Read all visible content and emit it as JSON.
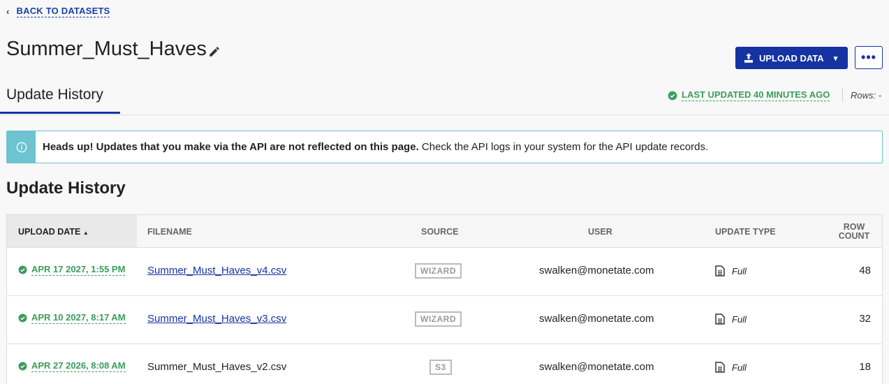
{
  "nav": {
    "back_label": "BACK TO DATASETS"
  },
  "header": {
    "title": "Summer_Must_Haves",
    "upload_label": "UPLOAD DATA"
  },
  "tab": {
    "label": "Update History",
    "last_updated": "LAST UPDATED 40 MINUTES AGO",
    "rows_label": "Rows: -"
  },
  "alert": {
    "bold": "Heads up! Updates that you make via the API are not reflected on this page.",
    "text": " Check the API logs in your system for the API update records."
  },
  "section": {
    "title": "Update History"
  },
  "table": {
    "headers": {
      "upload_date": "UPLOAD DATE",
      "filename": "FILENAME",
      "source": "SOURCE",
      "user": "USER",
      "update_type": "UPDATE TYPE",
      "row_count_1": "ROW",
      "row_count_2": "COUNT"
    },
    "rows": [
      {
        "date": "APR 17 2027, 1:55 PM",
        "filename": "Summer_Must_Haves_v4.csv",
        "source": "WIZARD",
        "user": "swalken@monetate.com",
        "type": "Full",
        "count": "48"
      },
      {
        "date": "APR 10 2027, 8:17 AM",
        "filename": "Summer_Must_Haves_v3.csv",
        "source": "WIZARD",
        "user": "swalken@monetate.com",
        "type": "Full",
        "count": "32"
      },
      {
        "date": "APR 27 2026, 8:08 AM",
        "filename": "Summer_Must_Haves_v2.csv",
        "source": "S3",
        "user": "swalken@monetate.com",
        "type": "Full",
        "count": "18"
      }
    ]
  },
  "colors": {
    "primary": "#1533a3",
    "success": "#3a9d5b",
    "info": "#6bc4cf"
  }
}
